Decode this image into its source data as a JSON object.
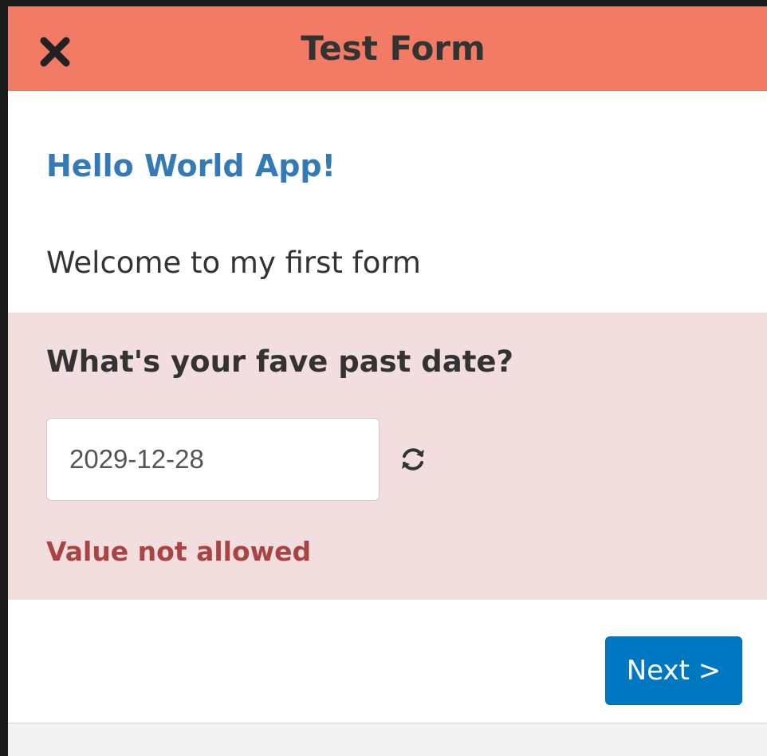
{
  "header": {
    "title": "Test Form",
    "close_icon": "close-icon",
    "background_color": "#f27b66"
  },
  "form": {
    "app_title": "Hello World App!",
    "welcome_text": "Welcome to my first form",
    "question": {
      "label": "What's your fave past date?",
      "value": "2029-12-28",
      "refresh_icon": "refresh-icon",
      "error": "Value not allowed",
      "error_color": "#a94442",
      "background_color": "#f2dede"
    }
  },
  "footer": {
    "next_label": "Next >",
    "next_color": "#0078c1"
  }
}
